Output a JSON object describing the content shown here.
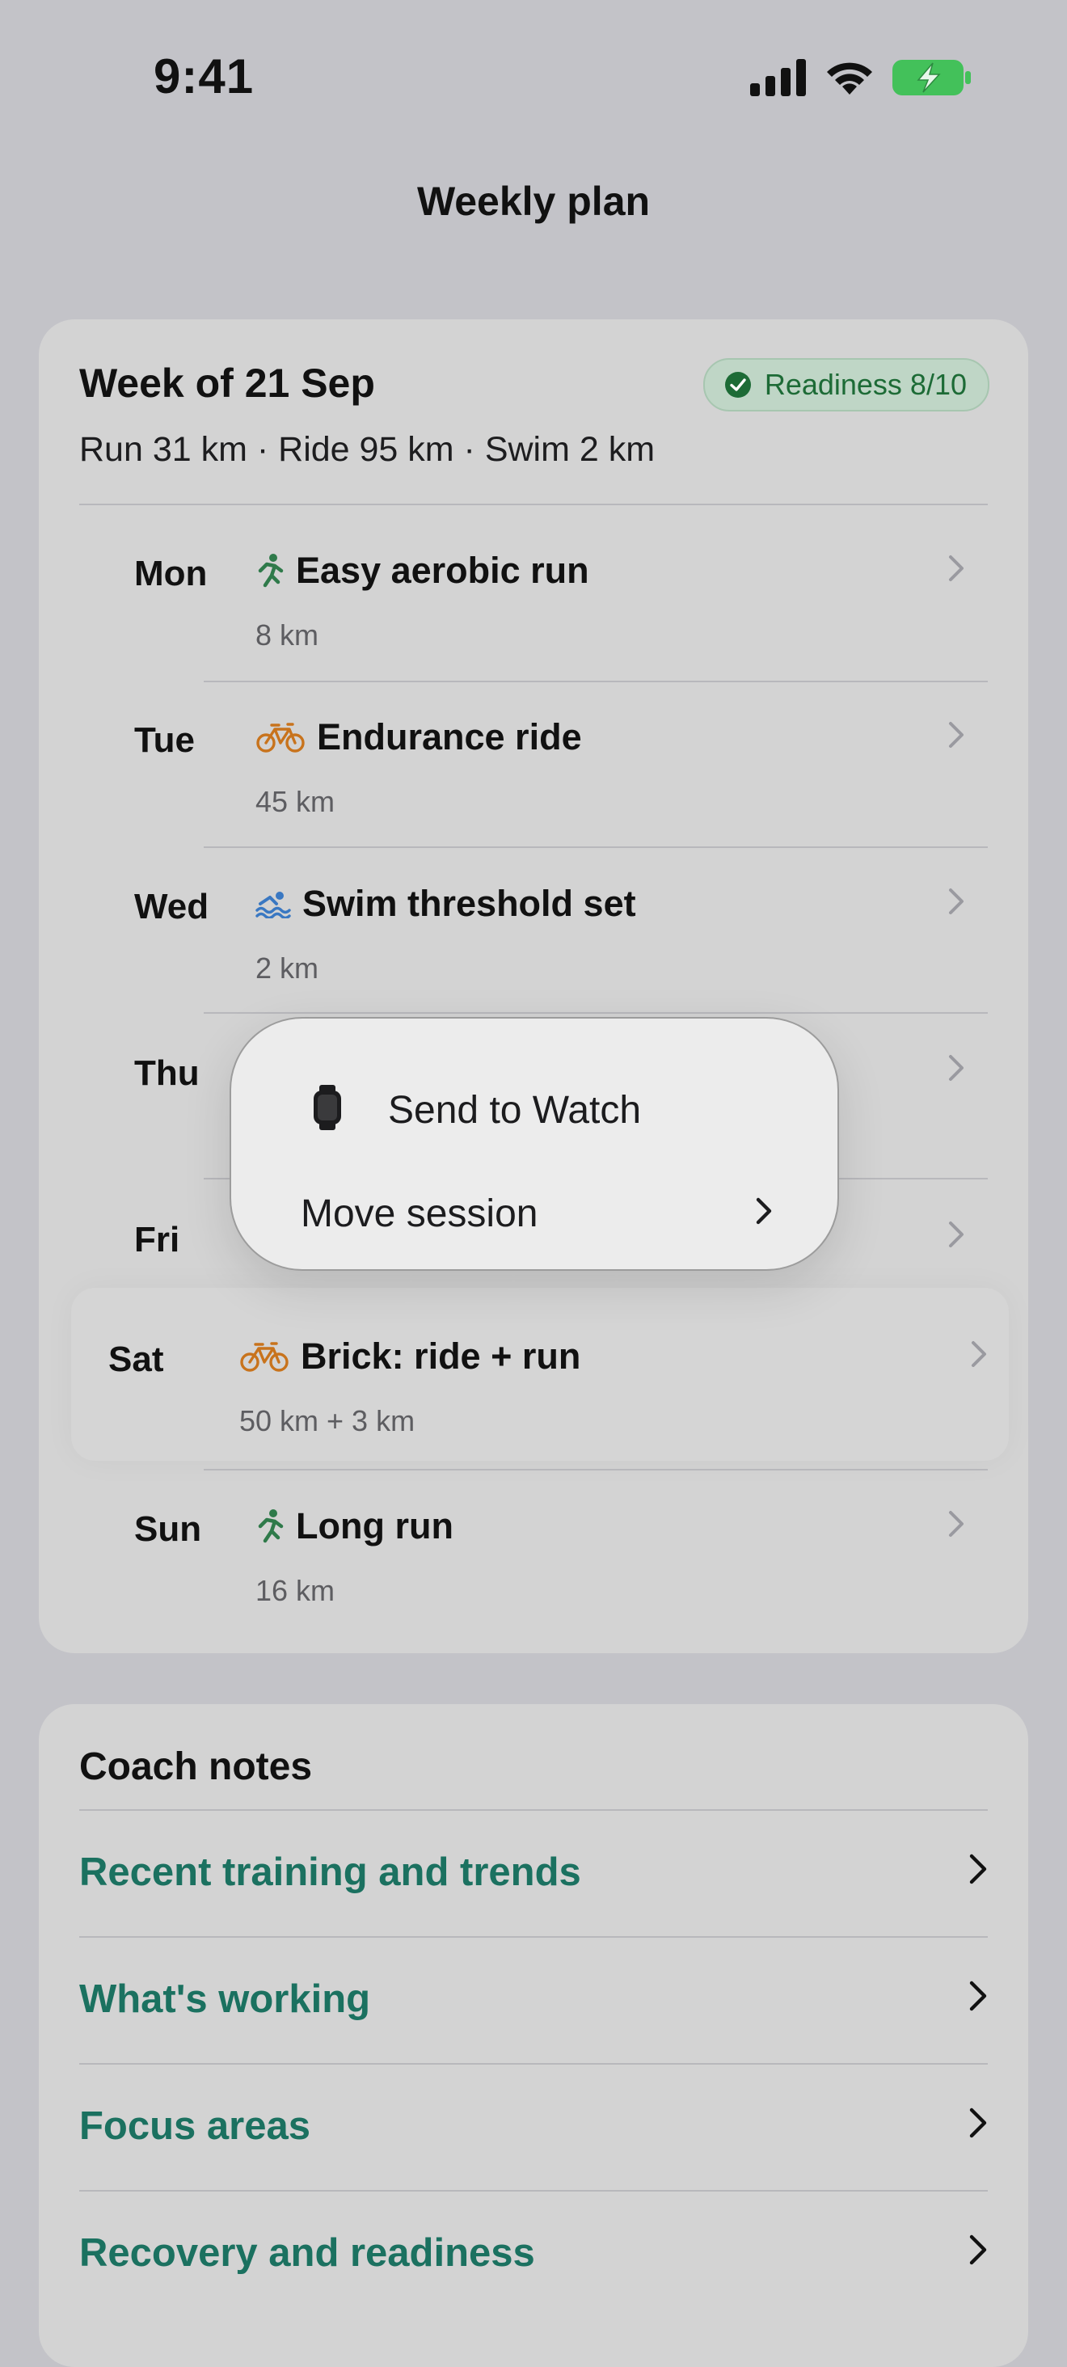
{
  "status_bar": {
    "time": "9:41"
  },
  "nav": {
    "title": "Weekly plan"
  },
  "plan": {
    "week_title": "Week of 21 Sep",
    "summary": "Run 31 km · Ride 95 km · Swim 2 km",
    "readiness_badge": "Readiness 8/10",
    "days": [
      {
        "day": "Mon",
        "icon": "run-icon",
        "session": "Easy aerobic run",
        "detail": "8 km"
      },
      {
        "day": "Tue",
        "icon": "bike-icon",
        "session": "Endurance ride",
        "detail": "45 km"
      },
      {
        "day": "Wed",
        "icon": "swim-icon",
        "session": "Swim threshold set",
        "detail": "2 km"
      },
      {
        "day": "Thu",
        "icon": "",
        "session": "",
        "detail": ""
      },
      {
        "day": "Fri",
        "icon": "",
        "session": "",
        "detail": ""
      },
      {
        "day": "Sat",
        "icon": "bike-icon",
        "session": "Brick: ride + run",
        "detail": "50 km + 3 km"
      },
      {
        "day": "Sun",
        "icon": "run-icon",
        "session": "Long run",
        "detail": "16 km"
      }
    ]
  },
  "context_menu": {
    "send_to_watch": "Send to Watch",
    "move_session": "Move session"
  },
  "coach_notes": {
    "title": "Coach notes",
    "links": [
      "Recent training and trends",
      "What's working",
      "Focus areas",
      "Recovery and readiness"
    ]
  },
  "colors": {
    "run": "#2f7a4a",
    "bike": "#c8731c",
    "swim": "#3a78c2",
    "accent_link": "#1b7160",
    "badge_text": "#1d6b36"
  }
}
